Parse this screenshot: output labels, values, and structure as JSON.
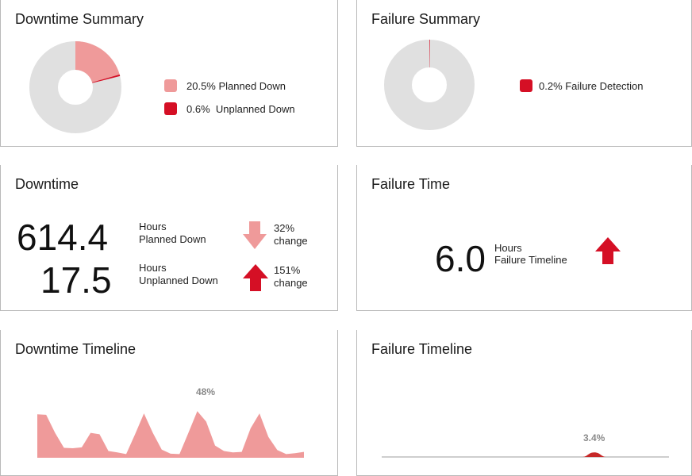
{
  "downtime_summary": {
    "title": "Downtime Summary",
    "legend": [
      {
        "label": "20.5% Planned Down",
        "color": "#ef9a9a"
      },
      {
        "label": "0.6%  Unplanned Down",
        "color": "#d50f25"
      }
    ],
    "donut": {
      "planned_fraction": 0.205,
      "unplanned_fraction": 0.006,
      "rest_color": "#e0e0e0"
    }
  },
  "failure_summary": {
    "title": "Failure Summary",
    "legend": [
      {
        "label": "0.2% Failure Detection",
        "color": "#d50f25"
      }
    ],
    "donut": {
      "failure_fraction": 0.002,
      "rest_color": "#e0e0e0"
    }
  },
  "downtime": {
    "title": "Downtime",
    "planned": {
      "value": "614.4",
      "label_line1": "Hours",
      "label_line2": "Planned Down",
      "change_pct": "32%",
      "change_word": "change",
      "direction": "down",
      "arrow_color": "#ef9a9a"
    },
    "unplanned": {
      "value": "17.5",
      "label_line1": "Hours",
      "label_line2": "Unplanned Down",
      "change_pct": "151%",
      "change_word": "change",
      "direction": "up",
      "arrow_color": "#d50f25"
    }
  },
  "failure_time": {
    "title": "Failure Time",
    "value": "6.0",
    "label_line1": "Hours",
    "label_line2": "Failure Timeline",
    "direction": "up",
    "arrow_color": "#d50f25"
  },
  "downtime_timeline": {
    "title": "Downtime Timeline",
    "peak_label": "48%",
    "fill_color": "#ef9a9a",
    "values": [
      0.96,
      0.95,
      0.55,
      0.22,
      0.21,
      0.23,
      0.55,
      0.52,
      0.15,
      0.12,
      0.08,
      0.52,
      0.98,
      0.55,
      0.18,
      0.09,
      0.08,
      0.55,
      1.03,
      0.8,
      0.27,
      0.15,
      0.12,
      0.13,
      0.65,
      0.98,
      0.46,
      0.17,
      0.08,
      0.1,
      0.13
    ]
  },
  "failure_timeline": {
    "title": "Failure Timeline",
    "peak_label": "3.4%",
    "fill_color": "#c62828",
    "baseline_color": "#9e9e9e",
    "bump_position": 0.74,
    "bump_height": 0.034
  }
}
